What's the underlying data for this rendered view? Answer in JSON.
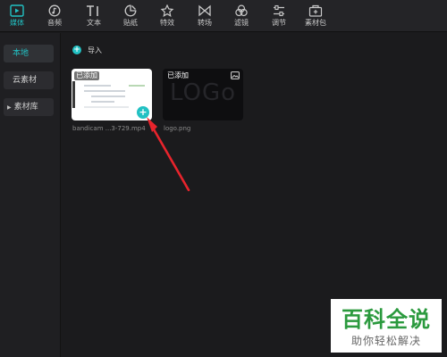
{
  "toolbar": {
    "tabs": [
      {
        "label": "媒体",
        "icon": "media-icon",
        "active": true
      },
      {
        "label": "音频",
        "icon": "audio-icon"
      },
      {
        "label": "文本",
        "icon": "text-icon"
      },
      {
        "label": "贴纸",
        "icon": "sticker-icon"
      },
      {
        "label": "特效",
        "icon": "effects-icon"
      },
      {
        "label": "转场",
        "icon": "transition-icon"
      },
      {
        "label": "滤镜",
        "icon": "filter-icon"
      },
      {
        "label": "调节",
        "icon": "adjust-icon"
      },
      {
        "label": "素材包",
        "icon": "material-pack-icon"
      }
    ]
  },
  "sidebar": {
    "items": [
      {
        "label": "本地",
        "active": true
      },
      {
        "label": "云素材"
      },
      {
        "label": "素材库",
        "expandable": true
      }
    ]
  },
  "main": {
    "import_label": "导入",
    "media": [
      {
        "badge": "已添加",
        "name": "bandicam ...3-729.mp4"
      },
      {
        "badge": "已添加",
        "name": "logo.png",
        "preview_text": "LOGo"
      }
    ]
  },
  "watermark": {
    "title": "百科全说",
    "subtitle": "助你轻松解决"
  },
  "colors": {
    "accent": "#22c1c3",
    "arrow": "#e8242c",
    "watermark_green": "#2b9a3e"
  }
}
